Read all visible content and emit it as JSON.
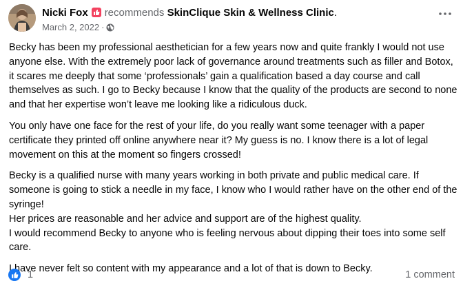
{
  "post": {
    "author": "Nicki Fox",
    "recommends_text": "recommends",
    "page_name": "SkinClique Skin & Wellness Clinic",
    "page_name_suffix": ".",
    "date": "March 2, 2022",
    "separator": "·",
    "paragraphs": [
      "Becky has been my professional aesthetician for a few years now and quite frankly I would not use anyone else. With the extremely poor lack of governance around treatments such as filler and Botox, it scares me deeply that some ‘professionals’ gain a qualification based a day course and call themselves as such. I go to Becky because I know that the quality of the products are second to none and that her expertise won’t leave me looking like a ridiculous duck.",
      "You only have one face for the rest of your life, do you really want some teenager with a paper certificate they printed off online anywhere near it? My guess is no. I know there is a lot of legal movement on this at the moment so fingers crossed!",
      "Becky is a qualified nurse with many years working in both private and public medical care. If someone is going to stick a needle in my face, I know who I would rather have on the other end of the syringe!",
      "Her prices are reasonable and her advice and support are of the highest quality.",
      "I would recommend Becky to anyone who is feeling nervous about dipping their toes into some self care.",
      "I have never felt so content with my appearance and a lot of that is down to Becky."
    ],
    "reaction_count": "1",
    "comment_count": "1 comment"
  },
  "icons": {
    "avatar": "profile-photo",
    "badge": "recommend-badge-icon",
    "privacy": "globe-icon",
    "more": "more-options-icon",
    "reaction": "like-icon"
  },
  "colors": {
    "badge": "#f3425f",
    "like": "#1877f2",
    "secondary_text": "#65676b"
  }
}
